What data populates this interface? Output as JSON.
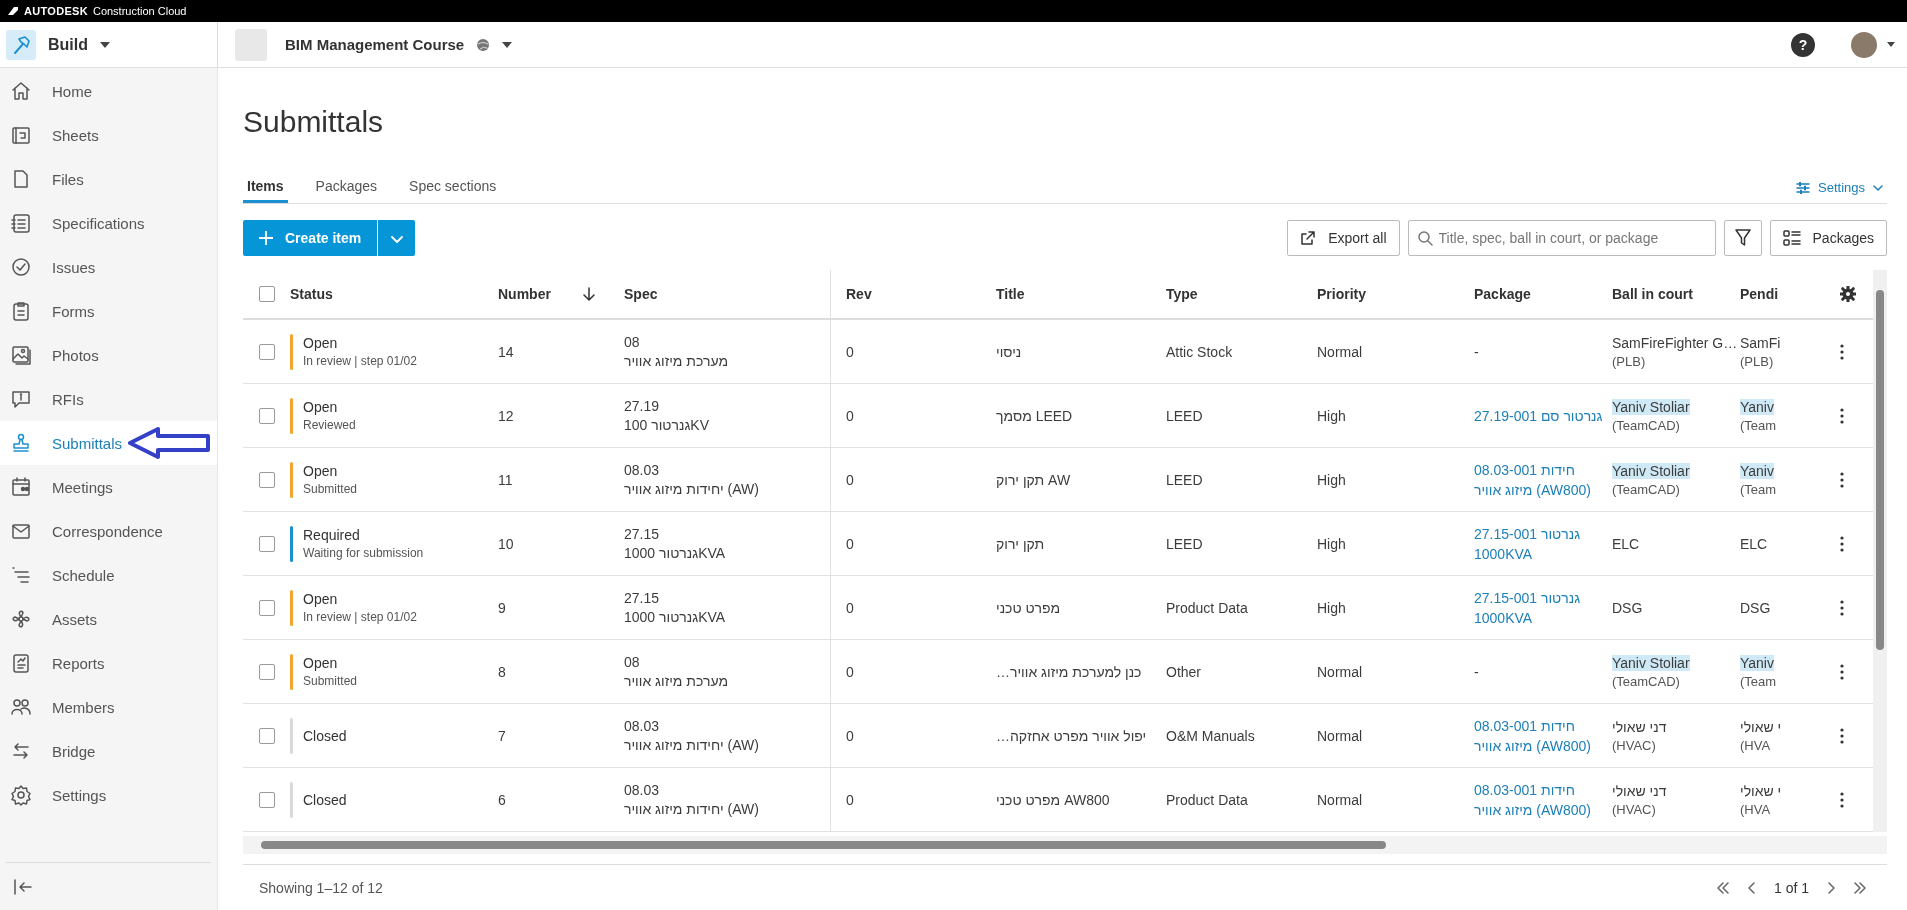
{
  "brand": {
    "name": "AUTODESK",
    "product": "Construction Cloud"
  },
  "header": {
    "app": "Build",
    "project": "BIM Management Course",
    "help": "?"
  },
  "sidebar": {
    "items": [
      {
        "label": "Home",
        "selected": false
      },
      {
        "label": "Sheets",
        "selected": false
      },
      {
        "label": "Files",
        "selected": false
      },
      {
        "label": "Specifications",
        "selected": false
      },
      {
        "label": "Issues",
        "selected": false
      },
      {
        "label": "Forms",
        "selected": false
      },
      {
        "label": "Photos",
        "selected": false
      },
      {
        "label": "RFIs",
        "selected": false
      },
      {
        "label": "Submittals",
        "selected": true
      },
      {
        "label": "Meetings",
        "selected": false
      },
      {
        "label": "Correspondence",
        "selected": false
      },
      {
        "label": "Schedule",
        "selected": false
      },
      {
        "label": "Assets",
        "selected": false
      },
      {
        "label": "Reports",
        "selected": false
      },
      {
        "label": "Members",
        "selected": false
      },
      {
        "label": "Bridge",
        "selected": false
      },
      {
        "label": "Settings",
        "selected": false
      }
    ]
  },
  "page": {
    "title": "Submittals",
    "settings": "Settings"
  },
  "tabs": [
    {
      "label": "Items",
      "selected": true
    },
    {
      "label": "Packages",
      "selected": false
    },
    {
      "label": "Spec sections",
      "selected": false
    }
  ],
  "toolbar": {
    "create": "Create item",
    "export": "Export all",
    "search": {
      "placeholder": "Title, spec, ball in court, or package"
    },
    "packages": "Packages"
  },
  "table": {
    "all_checked": false,
    "columns": [
      "Status",
      "Number",
      "Spec",
      "Rev",
      "Title",
      "Type",
      "Priority",
      "Package",
      "Ball in court",
      "Pendi"
    ],
    "rows": [
      {
        "checked": false,
        "status": "Open",
        "substatus": "In review | step 01/02",
        "color": "#f0a52e",
        "number": "14",
        "spec_code": "08",
        "spec_name": "מערכת מיזוג אוויר",
        "rev": "0",
        "title": "ניסוי",
        "type": "Attic Stock",
        "priority": "Normal",
        "package": {
          "kind": "text",
          "text": "-"
        },
        "ball": {
          "name": "SamFireFighter G…",
          "team": "(PLB)",
          "highlight": false
        },
        "pending": {
          "name": "SamFi",
          "team": "(PLB)",
          "highlight": false
        }
      },
      {
        "checked": false,
        "status": "Open",
        "substatus": "Reviewed",
        "color": "#f0a52e",
        "number": "12",
        "spec_code": "27.19",
        "spec_name": "גנרטור 100KV",
        "rev": "0",
        "title": "מסמך LEED",
        "type": "LEED",
        "priority": "High",
        "package": {
          "kind": "link",
          "text": "27.19-001 גנרטור סם"
        },
        "ball": {
          "name": "Yaniv Stoliar",
          "team": "(TeamCAD)",
          "highlight": true
        },
        "pending": {
          "name": "Yaniv",
          "team": "(Team",
          "highlight": true
        }
      },
      {
        "checked": false,
        "status": "Open",
        "substatus": "Submitted",
        "color": "#f0a52e",
        "number": "11",
        "spec_code": "08.03",
        "spec_name": "יחידות מיזוג אוויר (AW)",
        "rev": "0",
        "title": "תקן ירוק AW",
        "type": "LEED",
        "priority": "High",
        "package": {
          "kind": "link",
          "text": "08.03-001 חידות מיזוג אוויר (AW800)"
        },
        "ball": {
          "name": "Yaniv Stoliar",
          "team": "(TeamCAD)",
          "highlight": true
        },
        "pending": {
          "name": "Yaniv",
          "team": "(Team",
          "highlight": true
        }
      },
      {
        "checked": false,
        "status": "Required",
        "substatus": "Waiting for submission",
        "color": "#1b91d1",
        "number": "10",
        "spec_code": "27.15",
        "spec_name": "גנרטור 1000KVA",
        "rev": "0",
        "title": "תקן ירוק",
        "type": "LEED",
        "priority": "High",
        "package": {
          "kind": "link",
          "text": "27.15-001 גנרטור 1000KVA"
        },
        "ball": {
          "name": "ELC",
          "highlight": false
        },
        "pending": {
          "name": "ELC",
          "highlight": false
        }
      },
      {
        "checked": false,
        "status": "Open",
        "substatus": "In review | step 01/02",
        "color": "#f0a52e",
        "number": "9",
        "spec_code": "27.15",
        "spec_name": "גנרטור 1000KVA",
        "rev": "0",
        "title": "מפרט טכני",
        "type": "Product Data",
        "priority": "High",
        "package": {
          "kind": "link",
          "text": "27.15-001 גנרטור 1000KVA"
        },
        "ball": {
          "name": "DSG",
          "highlight": false
        },
        "pending": {
          "name": "DSG",
          "highlight": false
        }
      },
      {
        "checked": false,
        "status": "Open",
        "substatus": "Submitted",
        "color": "#f0a52e",
        "number": "8",
        "spec_code": "08",
        "spec_name": "מערכת מיזוג אוויר",
        "rev": "0",
        "title": "…כנן למערכת מיזוג אוויר",
        "type": "Other",
        "priority": "Normal",
        "package": {
          "kind": "text",
          "text": "-"
        },
        "ball": {
          "name": "Yaniv Stoliar",
          "team": "(TeamCAD)",
          "highlight": true
        },
        "pending": {
          "name": "Yaniv",
          "team": "(Team",
          "highlight": true
        }
      },
      {
        "checked": false,
        "status": "Closed",
        "color": "#d9d9d9",
        "number": "7",
        "spec_code": "08.03",
        "spec_name": "יחידות מיזוג אוויר (AW)",
        "rev": "0",
        "title": "…יפול אוויר מפרט אחזקה",
        "type": "O&M Manuals",
        "priority": "Normal",
        "package": {
          "kind": "link",
          "text": "08.03-001 חידות מיזוג אוויר (AW800)"
        },
        "ball": {
          "name": "דני שאולי",
          "team": "(HVAC)",
          "highlight": false
        },
        "pending": {
          "name": "י שאולי",
          "team": "(HVA",
          "highlight": false
        }
      },
      {
        "checked": false,
        "status": "Closed",
        "color": "#d9d9d9",
        "number": "6",
        "spec_code": "08.03",
        "spec_name": "יחידות מיזוג אוויר (AW)",
        "rev": "0",
        "title": "מפרט טכני AW800",
        "type": "Product Data",
        "priority": "Normal",
        "package": {
          "kind": "link",
          "text": "08.03-001 חידות מיזוג אוויר (AW800)"
        },
        "ball": {
          "name": "דני שאולי",
          "team": "(HVAC)",
          "highlight": false
        },
        "pending": {
          "name": "י שאולי",
          "team": "(HVA",
          "highlight": false
        }
      }
    ]
  },
  "footer": {
    "showing": "Showing 1–12 of 12",
    "page": "1 of 1"
  }
}
